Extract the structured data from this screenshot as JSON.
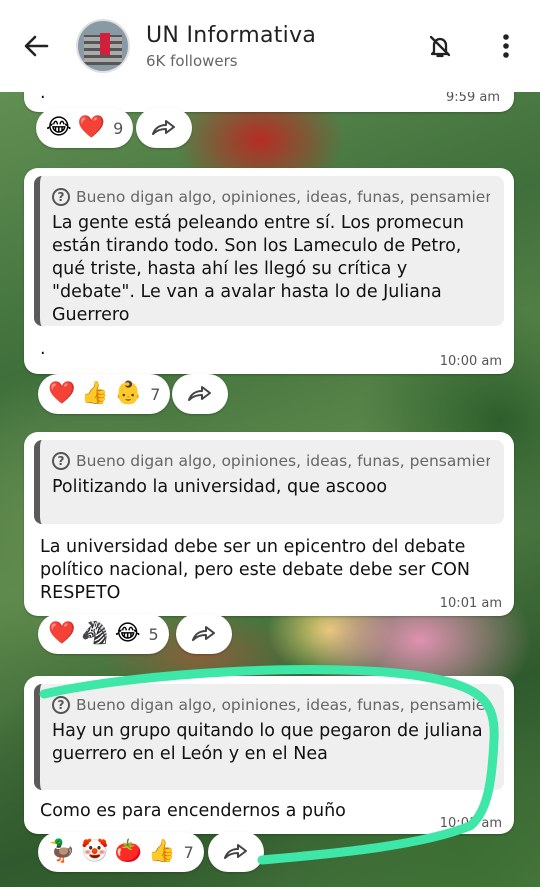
{
  "header": {
    "channel_name": "UN Informativa",
    "followers": "6K followers"
  },
  "messages": [
    {
      "body": ".",
      "time": "9:59 am",
      "reactions": {
        "emojis": [
          "😂",
          "❤️"
        ],
        "count": "9"
      }
    },
    {
      "quote_title": "Bueno digan algo, opiniones, ideas, funas, pensamientos...",
      "quote_text": "La gente está peleando entre sí. Los promecun están tirando todo. Son los Lameculo de Petro, qué triste, hasta ahí les llegó su crítica y \"debate\". Le van a avalar hasta lo de Juliana Guerrero",
      "body": ".",
      "time": "10:00 am",
      "reactions": {
        "emojis": [
          "❤️",
          "👍",
          "👶"
        ],
        "count": "7"
      }
    },
    {
      "quote_title": "Bueno digan algo, opiniones, ideas, funas, pensamientos...",
      "quote_text": "Politizando la universidad, que ascooo",
      "body": "La universidad debe ser un epicentro del debate político nacional, pero este debate debe ser CON RESPETO",
      "time": "10:01 am",
      "reactions": {
        "emojis": [
          "❤️",
          "🦓",
          "😂"
        ],
        "count": "5"
      }
    },
    {
      "quote_title": "Bueno digan algo, opiniones, ideas, funas, pensamiento",
      "quote_text": "Hay un grupo quitando lo que pegaron de juliana guerrero en el León y en el Nea",
      "body": "Como es para encendernos a puño",
      "time": "10:01 am",
      "reactions": {
        "emojis": [
          "🦆",
          "🤡",
          "🍅",
          "👍"
        ],
        "count": "7"
      }
    }
  ],
  "colors": {
    "header_bg": "#ffffff",
    "bubble_bg": "#ffffff",
    "quote_bg": "#efefef",
    "highlight": "#3ee6a8"
  }
}
